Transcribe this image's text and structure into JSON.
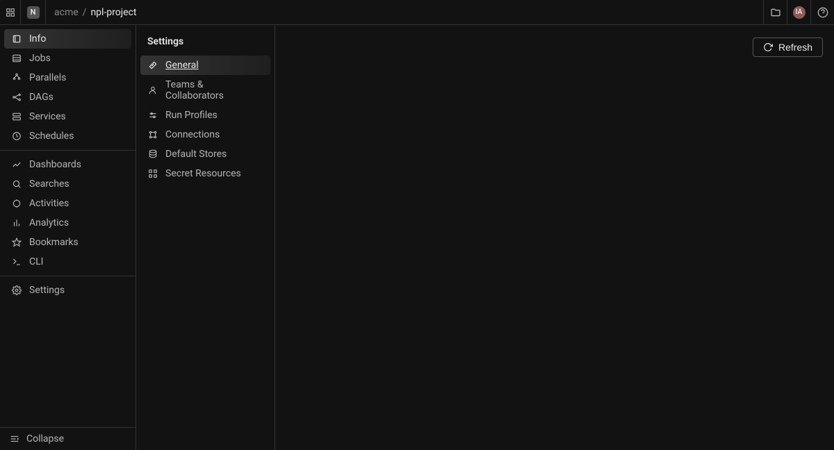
{
  "header": {
    "project_initial": "N",
    "breadcrumb_org": "acme",
    "breadcrumb_separator": "/",
    "breadcrumb_project": "npl-project",
    "avatar_initials": "IA"
  },
  "sidebar": {
    "items": [
      {
        "label": "Info"
      },
      {
        "label": "Jobs"
      },
      {
        "label": "Parallels"
      },
      {
        "label": "DAGs"
      },
      {
        "label": "Services"
      },
      {
        "label": "Schedules"
      },
      {
        "label": "Dashboards"
      },
      {
        "label": "Searches"
      },
      {
        "label": "Activities"
      },
      {
        "label": "Analytics"
      },
      {
        "label": "Bookmarks"
      },
      {
        "label": "CLI"
      },
      {
        "label": "Settings"
      }
    ],
    "collapse_label": "Collapse",
    "active_index": 0
  },
  "settings_panel": {
    "title": "Settings",
    "items": [
      {
        "label": "General"
      },
      {
        "label": "Teams & Collaborators"
      },
      {
        "label": "Run Profiles"
      },
      {
        "label": "Connections"
      },
      {
        "label": "Default Stores"
      },
      {
        "label": "Secret Resources"
      }
    ],
    "active_index": 0
  },
  "main": {
    "refresh_label": "Refresh"
  }
}
